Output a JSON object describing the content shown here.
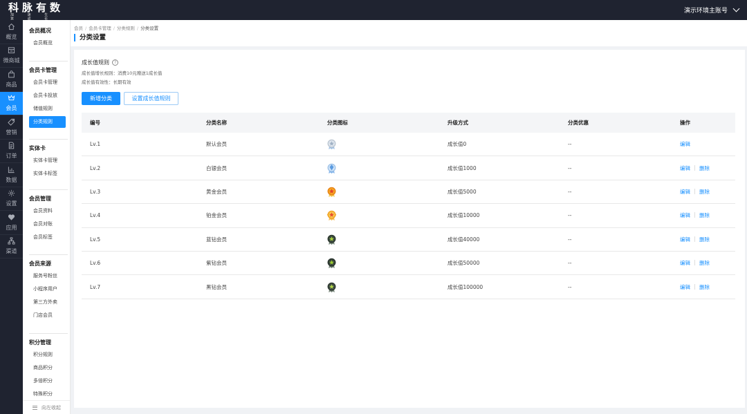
{
  "brand": {
    "name": "科脉有数",
    "tagline": "加 速 生 意 成 长"
  },
  "account": {
    "label": "演示环境主账号"
  },
  "rail": [
    {
      "label": "概览",
      "icon": "home-icon"
    },
    {
      "label": "微商城",
      "icon": "shop-icon"
    },
    {
      "label": "商品",
      "icon": "bag-icon"
    },
    {
      "label": "会员",
      "icon": "crown-icon",
      "active": true
    },
    {
      "label": "营销",
      "icon": "tag-icon"
    },
    {
      "label": "订单",
      "icon": "document-icon"
    },
    {
      "label": "数据",
      "icon": "bar-chart-icon"
    },
    {
      "label": "设置",
      "icon": "gear-icon"
    },
    {
      "label": "应用",
      "icon": "heart-icon"
    },
    {
      "label": "渠道",
      "icon": "network-icon"
    }
  ],
  "submenu": {
    "groups": [
      {
        "title": "会员概况",
        "items": [
          "会员概览"
        ]
      },
      {
        "title": "会员卡管理",
        "items": [
          "会员卡管理",
          "会员卡投放",
          "储值规则",
          "分类规则"
        ]
      },
      {
        "title": "实体卡",
        "items": [
          "实体卡管理",
          "实体卡标签"
        ]
      },
      {
        "title": "会员管理",
        "items": [
          "会员资料",
          "会员对账",
          "会员标签"
        ]
      },
      {
        "title": "会员来源",
        "items": [
          "服务号粉丝",
          "小程序用户",
          "第三方外卖",
          "门店会员"
        ]
      },
      {
        "title": "积分管理",
        "items": [
          "积分规则",
          "商品积分",
          "多倍积分",
          "特殊积分"
        ]
      }
    ],
    "active_item": "分类规则",
    "collapse_label": "向左收起"
  },
  "breadcrumb": [
    "会员",
    "会员卡管理",
    "分类规则",
    "分类设置"
  ],
  "page_title": "分类设置",
  "growth_rule": {
    "title": "成长值规则",
    "line1": "成长值增长规则：消费10元赠送1成长值",
    "line2": "成长值有效性：长期有效"
  },
  "buttons": {
    "add": "新增分类",
    "set_rule": "设置成长值规则"
  },
  "table": {
    "headers": [
      "编号",
      "分类名称",
      "分类图标",
      "升级方式",
      "分类优惠",
      "操作"
    ],
    "edit_label": "编辑",
    "delete_label": "删除",
    "rows": [
      {
        "id": "Lv.1",
        "name": "默认会员",
        "icon": "silver-medal-icon",
        "upgrade": "成长值0",
        "discount": "--",
        "deletable": false
      },
      {
        "id": "Lv.2",
        "name": "白银会员",
        "icon": "diamond-medal-icon",
        "upgrade": "成长值1000",
        "discount": "--",
        "deletable": true
      },
      {
        "id": "Lv.3",
        "name": "黄金会员",
        "icon": "gold-medal-icon",
        "upgrade": "成长值5000",
        "discount": "--",
        "deletable": true
      },
      {
        "id": "Lv.4",
        "name": "铂金会员",
        "icon": "platinum-medal-icon",
        "upgrade": "成长值10000",
        "discount": "--",
        "deletable": true
      },
      {
        "id": "Lv.5",
        "name": "蓝钻会员",
        "icon": "blue-diamond-medal-icon",
        "upgrade": "成长值40000",
        "discount": "--",
        "deletable": true
      },
      {
        "id": "Lv.6",
        "name": "紫钻会员",
        "icon": "purple-diamond-medal-icon",
        "upgrade": "成长值50000",
        "discount": "--",
        "deletable": true
      },
      {
        "id": "Lv.7",
        "name": "黑钻会员",
        "icon": "black-diamond-medal-icon",
        "upgrade": "成长值100000",
        "discount": "--",
        "deletable": true
      }
    ]
  },
  "colors": {
    "primary": "#1890ff",
    "topbar": "#1f2330",
    "background": "#f0f2f5"
  }
}
